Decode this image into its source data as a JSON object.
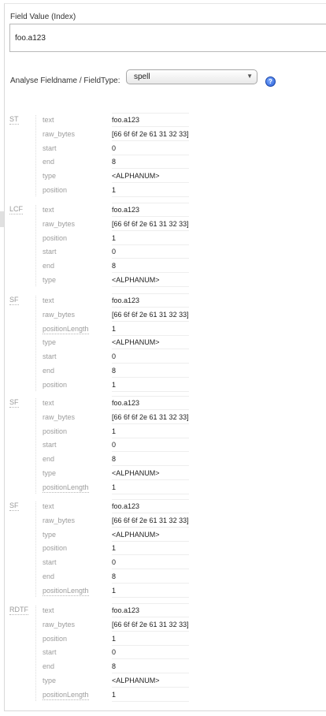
{
  "field_value": {
    "label": "Field Value (Index)",
    "value": "foo.a123"
  },
  "analyse": {
    "label": "Analyse Fieldname / FieldType:",
    "selected": "spell",
    "help_icon": "question-circle-icon"
  },
  "stages": [
    {
      "name": "ST",
      "rows": [
        {
          "attr": "text",
          "value": "foo.a123"
        },
        {
          "attr": "raw_bytes",
          "value": "[66 6f 6f 2e 61 31 32 33]"
        },
        {
          "attr": "start",
          "value": "0"
        },
        {
          "attr": "end",
          "value": "8"
        },
        {
          "attr": "type",
          "value": "<ALPHANUM>"
        },
        {
          "attr": "position",
          "value": "1"
        }
      ]
    },
    {
      "name": "LCF",
      "rows": [
        {
          "attr": "text",
          "value": "foo.a123"
        },
        {
          "attr": "raw_bytes",
          "value": "[66 6f 6f 2e 61 31 32 33]"
        },
        {
          "attr": "position",
          "value": "1"
        },
        {
          "attr": "start",
          "value": "0"
        },
        {
          "attr": "end",
          "value": "8"
        },
        {
          "attr": "type",
          "value": "<ALPHANUM>"
        }
      ]
    },
    {
      "name": "SF",
      "rows": [
        {
          "attr": "text",
          "value": "foo.a123"
        },
        {
          "attr": "raw_bytes",
          "value": "[66 6f 6f 2e 61 31 32 33]"
        },
        {
          "attr": "positionLength",
          "value": "1"
        },
        {
          "attr": "type",
          "value": "<ALPHANUM>"
        },
        {
          "attr": "start",
          "value": "0"
        },
        {
          "attr": "end",
          "value": "8"
        },
        {
          "attr": "position",
          "value": "1"
        }
      ]
    },
    {
      "name": "SF",
      "rows": [
        {
          "attr": "text",
          "value": "foo.a123"
        },
        {
          "attr": "raw_bytes",
          "value": "[66 6f 6f 2e 61 31 32 33]"
        },
        {
          "attr": "position",
          "value": "1"
        },
        {
          "attr": "start",
          "value": "0"
        },
        {
          "attr": "end",
          "value": "8"
        },
        {
          "attr": "type",
          "value": "<ALPHANUM>"
        },
        {
          "attr": "positionLength",
          "value": "1"
        }
      ]
    },
    {
      "name": "SF",
      "rows": [
        {
          "attr": "text",
          "value": "foo.a123"
        },
        {
          "attr": "raw_bytes",
          "value": "[66 6f 6f 2e 61 31 32 33]"
        },
        {
          "attr": "type",
          "value": "<ALPHANUM>"
        },
        {
          "attr": "position",
          "value": "1"
        },
        {
          "attr": "start",
          "value": "0"
        },
        {
          "attr": "end",
          "value": "8"
        },
        {
          "attr": "positionLength",
          "value": "1"
        }
      ]
    },
    {
      "name": "RDTF",
      "rows": [
        {
          "attr": "text",
          "value": "foo.a123"
        },
        {
          "attr": "raw_bytes",
          "value": "[66 6f 6f 2e 61 31 32 33]"
        },
        {
          "attr": "position",
          "value": "1"
        },
        {
          "attr": "start",
          "value": "0"
        },
        {
          "attr": "end",
          "value": "8"
        },
        {
          "attr": "type",
          "value": "<ALPHANUM>"
        },
        {
          "attr": "positionLength",
          "value": "1"
        }
      ]
    }
  ]
}
